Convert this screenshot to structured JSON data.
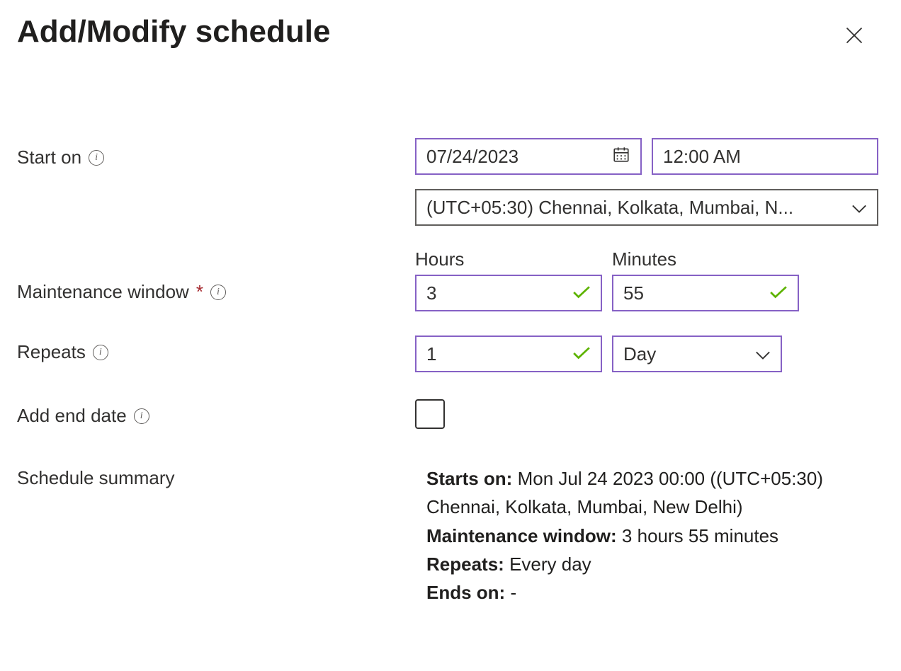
{
  "title": "Add/Modify schedule",
  "labels": {
    "startOn": "Start on",
    "maintenance": "Maintenance window",
    "repeats": "Repeats",
    "addEndDate": "Add end date",
    "summary": "Schedule summary",
    "hours": "Hours",
    "minutes": "Minutes"
  },
  "values": {
    "date": "07/24/2023",
    "time": "12:00 AM",
    "timezone": "(UTC+05:30) Chennai, Kolkata, Mumbai, N...",
    "hours": "3",
    "minutes": "55",
    "repeatCount": "1",
    "repeatUnit": "Day",
    "endDateChecked": false
  },
  "summary": {
    "startsOnLabel": "Starts on:",
    "startsOn": "Mon Jul 24 2023 00:00 ((UTC+05:30) Chennai, Kolkata, Mumbai, New Delhi)",
    "maintLabel": "Maintenance window:",
    "maint": "3 hours 55 minutes",
    "repeatsLabel": "Repeats:",
    "repeats": "Every day",
    "endsOnLabel": "Ends on:",
    "endsOn": "-"
  }
}
